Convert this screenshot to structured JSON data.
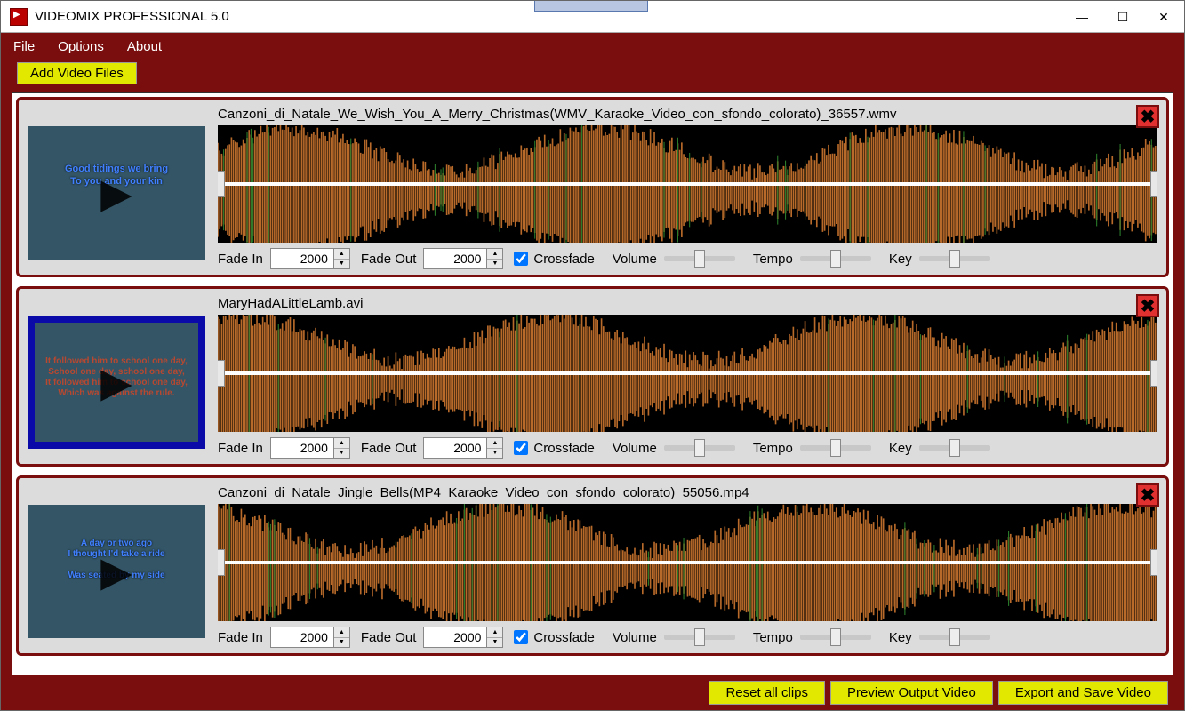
{
  "app": {
    "title": "VIDEOMIX PROFESSIONAL 5.0"
  },
  "menu": {
    "file": "File",
    "options": "Options",
    "about": "About"
  },
  "toolbar": {
    "add": "Add Video Files"
  },
  "labels": {
    "fade_in": "Fade In",
    "fade_out": "Fade Out",
    "crossfade": "Crossfade",
    "volume": "Volume",
    "tempo": "Tempo",
    "key": "Key"
  },
  "clips": [
    {
      "filename": "Canzoni_di_Natale_We_Wish_You_A_Merry_Christmas(WMV_Karaoke_Video_con_sfondo_colorato)_36557.wmv",
      "fade_in": "2000",
      "fade_out": "2000",
      "crossfade": true,
      "thumb_lines": [
        "Good tidings we bring",
        "To you and your kin"
      ]
    },
    {
      "filename": "MaryHadALittleLamb.avi",
      "fade_in": "2000",
      "fade_out": "2000",
      "crossfade": true,
      "thumb_lines": [
        "It followed him to school one day,",
        "School one day, school one day,",
        "It followed him to school one day,",
        "Which was against the rule."
      ]
    },
    {
      "filename": "Canzoni_di_Natale_Jingle_Bells(MP4_Karaoke_Video_con_sfondo_colorato)_55056.mp4",
      "fade_in": "2000",
      "fade_out": "2000",
      "crossfade": true,
      "thumb_lines": [
        "A day or two ago",
        "I thought I'd take a ride",
        "Was seated by my side"
      ]
    }
  ],
  "footer": {
    "reset": "Reset all clips",
    "preview": "Preview Output Video",
    "export": "Export and Save Video"
  }
}
